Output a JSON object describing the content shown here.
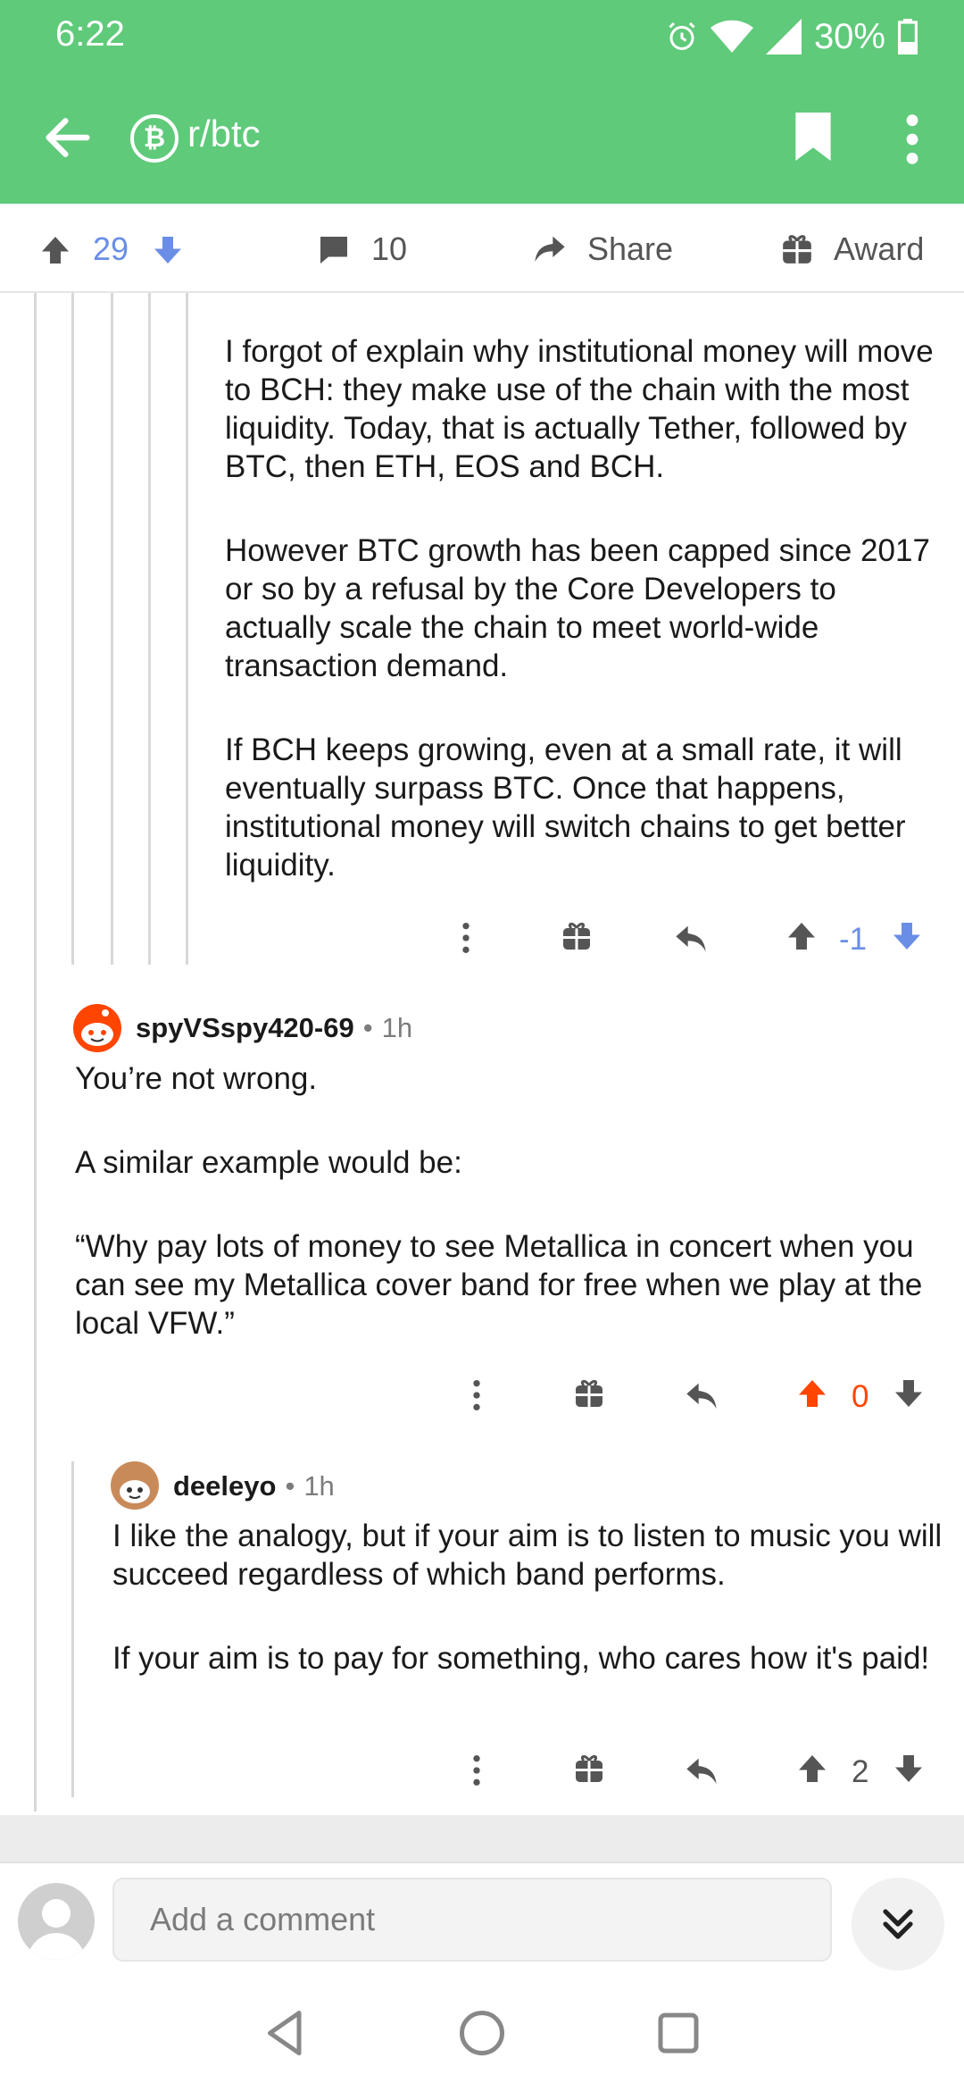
{
  "status_bar": {
    "time": "6:22",
    "battery": "30%"
  },
  "header": {
    "subreddit": "r/btc",
    "icon_glyph": "₿",
    "accent": "#5fca7a"
  },
  "post_bar": {
    "score": "29",
    "comments": "10",
    "share_label": "Share",
    "award_label": "Award"
  },
  "comments": [
    {
      "paragraphs": [
        "I forgot of explain why institutional money will move to BCH: they make use of the chain with the most liquidity. Today, that is actually Tether, followed by BTC, then ETH, EOS and BCH.",
        "However BTC growth has been capped since 2017 or so by a refusal by the Core Developers to actually scale the chain to meet world-wide transaction demand.",
        "If BCH keeps growing, even at a small rate, it will eventually surpass BTC. Once that happens, institutional money will switch chains to get better liquidity."
      ],
      "score": "-1",
      "score_color": "#6a8ee6",
      "vote_state": "downvoted"
    },
    {
      "author": "spyVSspy420-69",
      "separator": "•",
      "age": "1h",
      "paragraphs": [
        "You’re not wrong.",
        "A similar example would be:",
        "“Why pay lots of money to see Metallica in concert when you can see my Metallica cover band for free when we play at the local VFW.”"
      ],
      "score": "0",
      "score_color": "#ff4500",
      "vote_state": "upvoted"
    },
    {
      "author": "deeleyo",
      "separator": "•",
      "age": "1h",
      "paragraphs": [
        "I like the analogy, but if your aim is to listen to music you will succeed regardless of which band performs.",
        "If your aim is to pay for something, who cares how it's paid!"
      ],
      "score": "2",
      "score_color": "#555555",
      "vote_state": "none"
    }
  ],
  "composer": {
    "placeholder": "Add a comment"
  },
  "icons": {
    "back": "arrow-left-icon",
    "bookmark": "bookmark-icon",
    "more": "more-vertical-icon",
    "upvote": "arrow-up-icon",
    "downvote": "arrow-down-icon",
    "comment": "speech-bubble-icon",
    "share": "share-arrow-icon",
    "award": "gift-icon",
    "reply": "reply-arrow-icon",
    "collapse": "double-chevron-down-icon"
  }
}
